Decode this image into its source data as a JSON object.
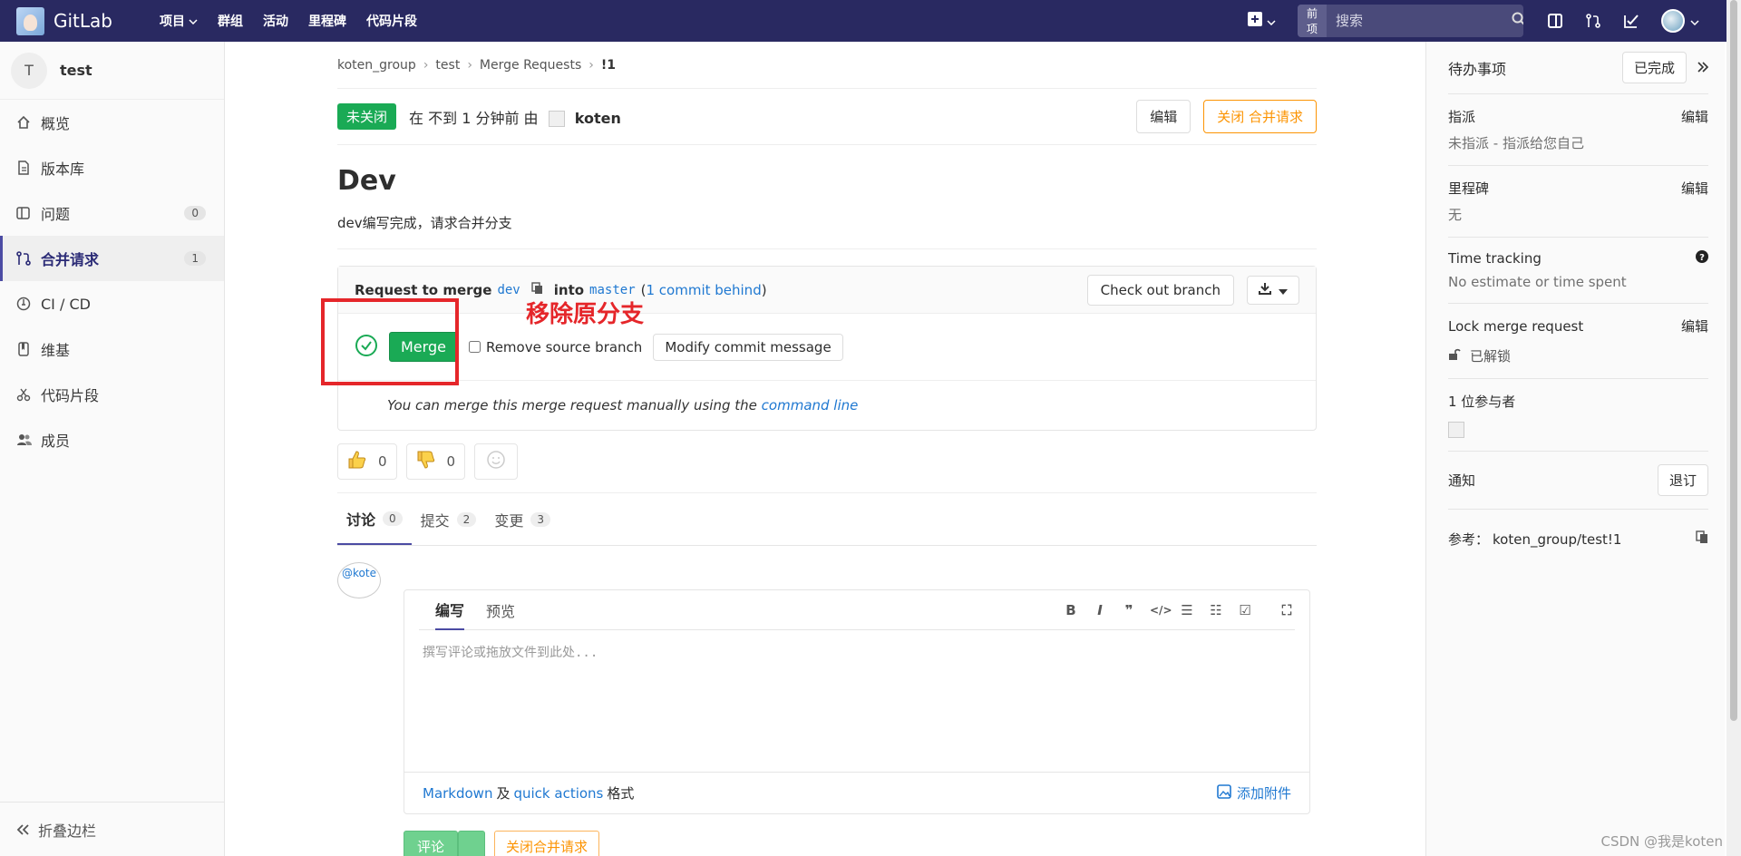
{
  "navbar": {
    "logo_text": "GitLab",
    "links": [
      "项目",
      "群组",
      "活动",
      "里程碑",
      "代码片段"
    ],
    "search_scope": "当前项目",
    "search_placeholder": "搜索"
  },
  "sidebar": {
    "project_initial": "T",
    "project_name": "test",
    "items": [
      {
        "label": "概览",
        "icon": "home-icon"
      },
      {
        "label": "版本库",
        "icon": "doc-icon"
      },
      {
        "label": "问题",
        "icon": "issues-icon",
        "count": "0"
      },
      {
        "label": "合并请求",
        "icon": "merge-request-icon",
        "count": "1",
        "active": true
      },
      {
        "label": "CI / CD",
        "icon": "rocket-icon"
      },
      {
        "label": "维基",
        "icon": "book-icon"
      },
      {
        "label": "代码片段",
        "icon": "snippet-icon"
      },
      {
        "label": "成员",
        "icon": "users-icon"
      }
    ],
    "collapse_label": "折叠边栏"
  },
  "breadcrumb": [
    "koten_group",
    "test",
    "Merge Requests",
    "!1"
  ],
  "mr": {
    "status": "未关闭",
    "meta_prefix": "在 不到 1 分钟前 由",
    "author": "koten",
    "edit_label": "编辑",
    "close_label": "关闭 合并请求",
    "title": "Dev",
    "description": "dev编写完成，请求合并分支"
  },
  "widget": {
    "request_to_merge": "Request to merge",
    "source_branch": "dev",
    "into": "into",
    "target_branch": "master",
    "commits_behind": "1 commit behind",
    "checkout_label": "Check out branch",
    "merge_label": "Merge",
    "remove_source_label": "Remove source branch",
    "modify_commit_label": "Modify commit message",
    "help_prefix": "You can merge this merge request manually using the",
    "help_link": "command line"
  },
  "annotation": "移除原分支",
  "awards": {
    "thumbs_up": "0",
    "thumbs_down": "0"
  },
  "tabs": [
    {
      "label": "讨论",
      "count": "0"
    },
    {
      "label": "提交",
      "count": "2"
    },
    {
      "label": "变更",
      "count": "3"
    }
  ],
  "comment": {
    "avatar_alt": "@kote",
    "write_tab": "编写",
    "preview_tab": "预览",
    "placeholder": "撰写评论或拖放文件到此处...",
    "markdown_link": "Markdown",
    "and": "及",
    "quick_actions_link": "quick actions",
    "format": "格式",
    "attach_label": "添加附件",
    "submit_label": "评论",
    "close_label": "关闭合并请求"
  },
  "right_sidebar": {
    "todo_label": "待办事项",
    "done_button": "已完成",
    "assignee_title": "指派",
    "assignee_value": "未指派 - 指派给您自己",
    "milestone_title": "里程碑",
    "milestone_value": "无",
    "time_tracking_title": "Time tracking",
    "time_tracking_value": "No estimate or time spent",
    "lock_title": "Lock merge request",
    "lock_value": "已解锁",
    "edit_label": "编辑",
    "participants_title": "1 位参与者",
    "notify_title": "通知",
    "unsubscribe_label": "退订",
    "reference_label": "参考：",
    "reference_value": "koten_group/test!1"
  },
  "watermark": "CSDN @我是koten",
  "colors": {
    "navbar": "#292961",
    "success": "#1aaa55",
    "warning": "#fc9403",
    "link": "#1f78d1",
    "annotation": "#e5262a"
  }
}
